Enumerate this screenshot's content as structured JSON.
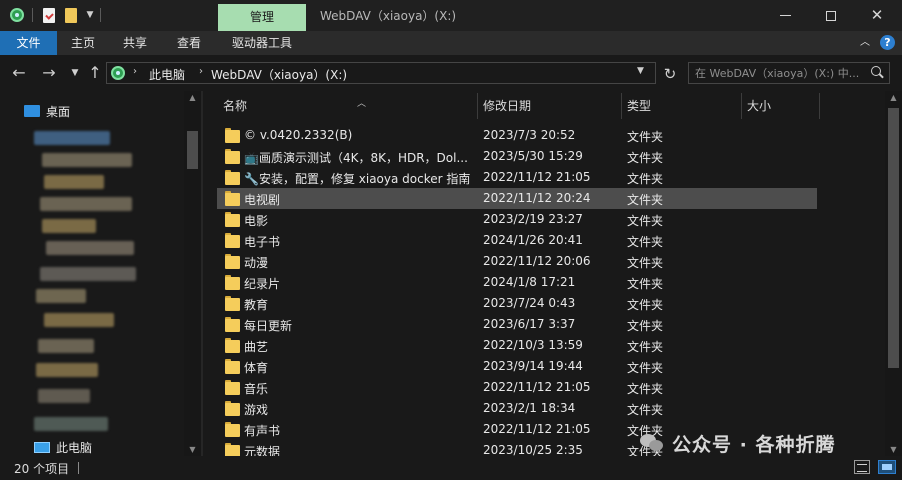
{
  "title_bar": {
    "manage_tab": "管理",
    "window_title": "WebDAV（xiaoya）(X:)"
  },
  "ribbon": {
    "tabs": [
      "文件",
      "主页",
      "共享",
      "查看",
      "驱动器工具"
    ]
  },
  "address_bar": {
    "breadcrumbs": [
      "此电脑",
      "WebDAV（xiaoya）(X:)"
    ]
  },
  "search": {
    "placeholder": "在 WebDAV（xiaoya）(X:) 中..."
  },
  "nav_pane": {
    "desktop": "桌面",
    "this_pc": "此电脑"
  },
  "columns": {
    "name": "名称",
    "date": "修改日期",
    "type": "类型",
    "size": "大小"
  },
  "files": [
    {
      "name": "© v.0420.2332(B)",
      "date": "2023/7/3 20:52",
      "type": "文件夹"
    },
    {
      "name": "📺画质演示测试（4K，8K，HDR，Dol...",
      "date": "2023/5/30 15:29",
      "type": "文件夹"
    },
    {
      "name": "🔧安装，配置，修复 xiaoya docker 指南",
      "date": "2022/11/12 21:05",
      "type": "文件夹"
    },
    {
      "name": "电视剧",
      "date": "2022/11/12 20:24",
      "type": "文件夹"
    },
    {
      "name": "电影",
      "date": "2023/2/19 23:27",
      "type": "文件夹"
    },
    {
      "name": "电子书",
      "date": "2024/1/26 20:41",
      "type": "文件夹"
    },
    {
      "name": "动漫",
      "date": "2022/11/12 20:06",
      "type": "文件夹"
    },
    {
      "name": "纪录片",
      "date": "2024/1/8 17:21",
      "type": "文件夹"
    },
    {
      "name": "教育",
      "date": "2023/7/24 0:43",
      "type": "文件夹"
    },
    {
      "name": "每日更新",
      "date": "2023/6/17 3:37",
      "type": "文件夹"
    },
    {
      "name": "曲艺",
      "date": "2022/10/3 13:59",
      "type": "文件夹"
    },
    {
      "name": "体育",
      "date": "2023/9/14 19:44",
      "type": "文件夹"
    },
    {
      "name": "音乐",
      "date": "2022/11/12 21:05",
      "type": "文件夹"
    },
    {
      "name": "游戏",
      "date": "2023/2/1 18:34",
      "type": "文件夹"
    },
    {
      "name": "有声书",
      "date": "2022/11/12 21:05",
      "type": "文件夹"
    },
    {
      "name": "元数据",
      "date": "2023/10/25 2:35",
      "type": "文件夹"
    }
  ],
  "selected_row": 3,
  "status": {
    "item_count": "20 个项目"
  },
  "watermark": {
    "text": "公众号 · 各种折腾"
  },
  "colors": {
    "file_tab_bg": "#1f6fb5",
    "manage_tab_bg": "#a7ddb0",
    "folder": "#f5cd5b",
    "selected_row": "#4d4d4d"
  }
}
